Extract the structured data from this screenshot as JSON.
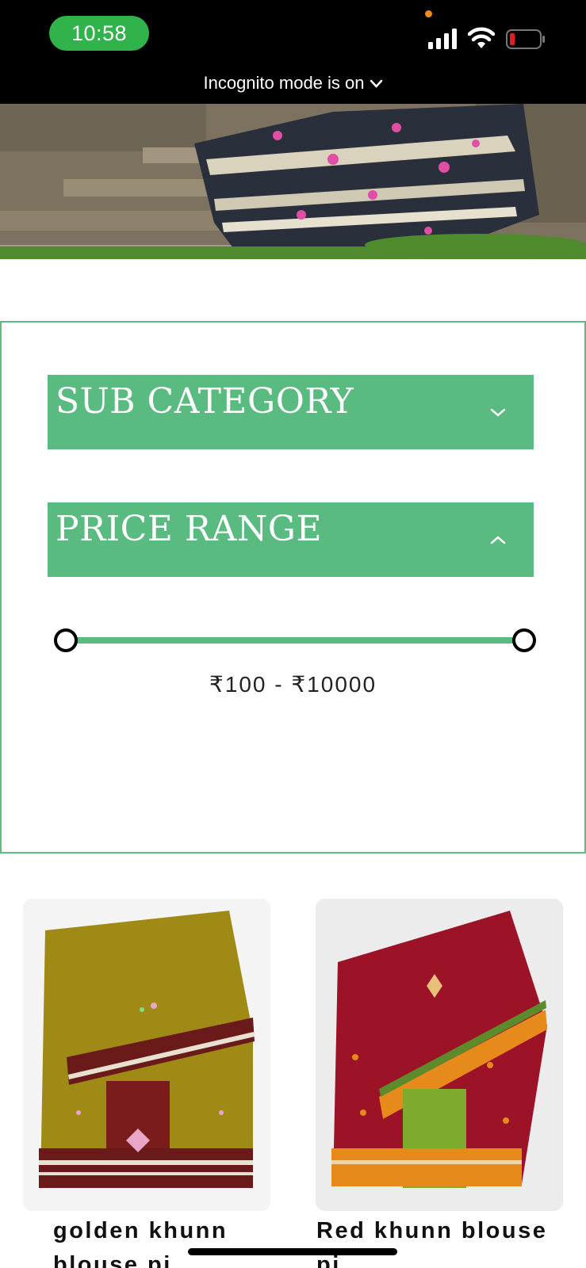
{
  "status_bar": {
    "time": "10:58",
    "incognito_text": "Incognito mode is on",
    "icons": [
      "signal-icon",
      "wifi-icon",
      "battery-low-icon",
      "chevron-down-icon"
    ]
  },
  "filters": {
    "sub_category": {
      "label": "SUB CATEGORY",
      "state": "collapsed"
    },
    "price_range": {
      "label": "PRICE RANGE",
      "state": "expanded",
      "display": "₹100 - ₹10000"
    }
  },
  "products": [
    {
      "name_line1": "golden khunn",
      "name_line2": "blouse pi"
    },
    {
      "name_line1": "Red khunn blouse",
      "name_line2": "pi"
    }
  ],
  "colors": {
    "accent_green": "#5abb80",
    "time_pill": "#2fb34a",
    "status_bar_bg": "#000000",
    "battery_low": "#e02020"
  }
}
